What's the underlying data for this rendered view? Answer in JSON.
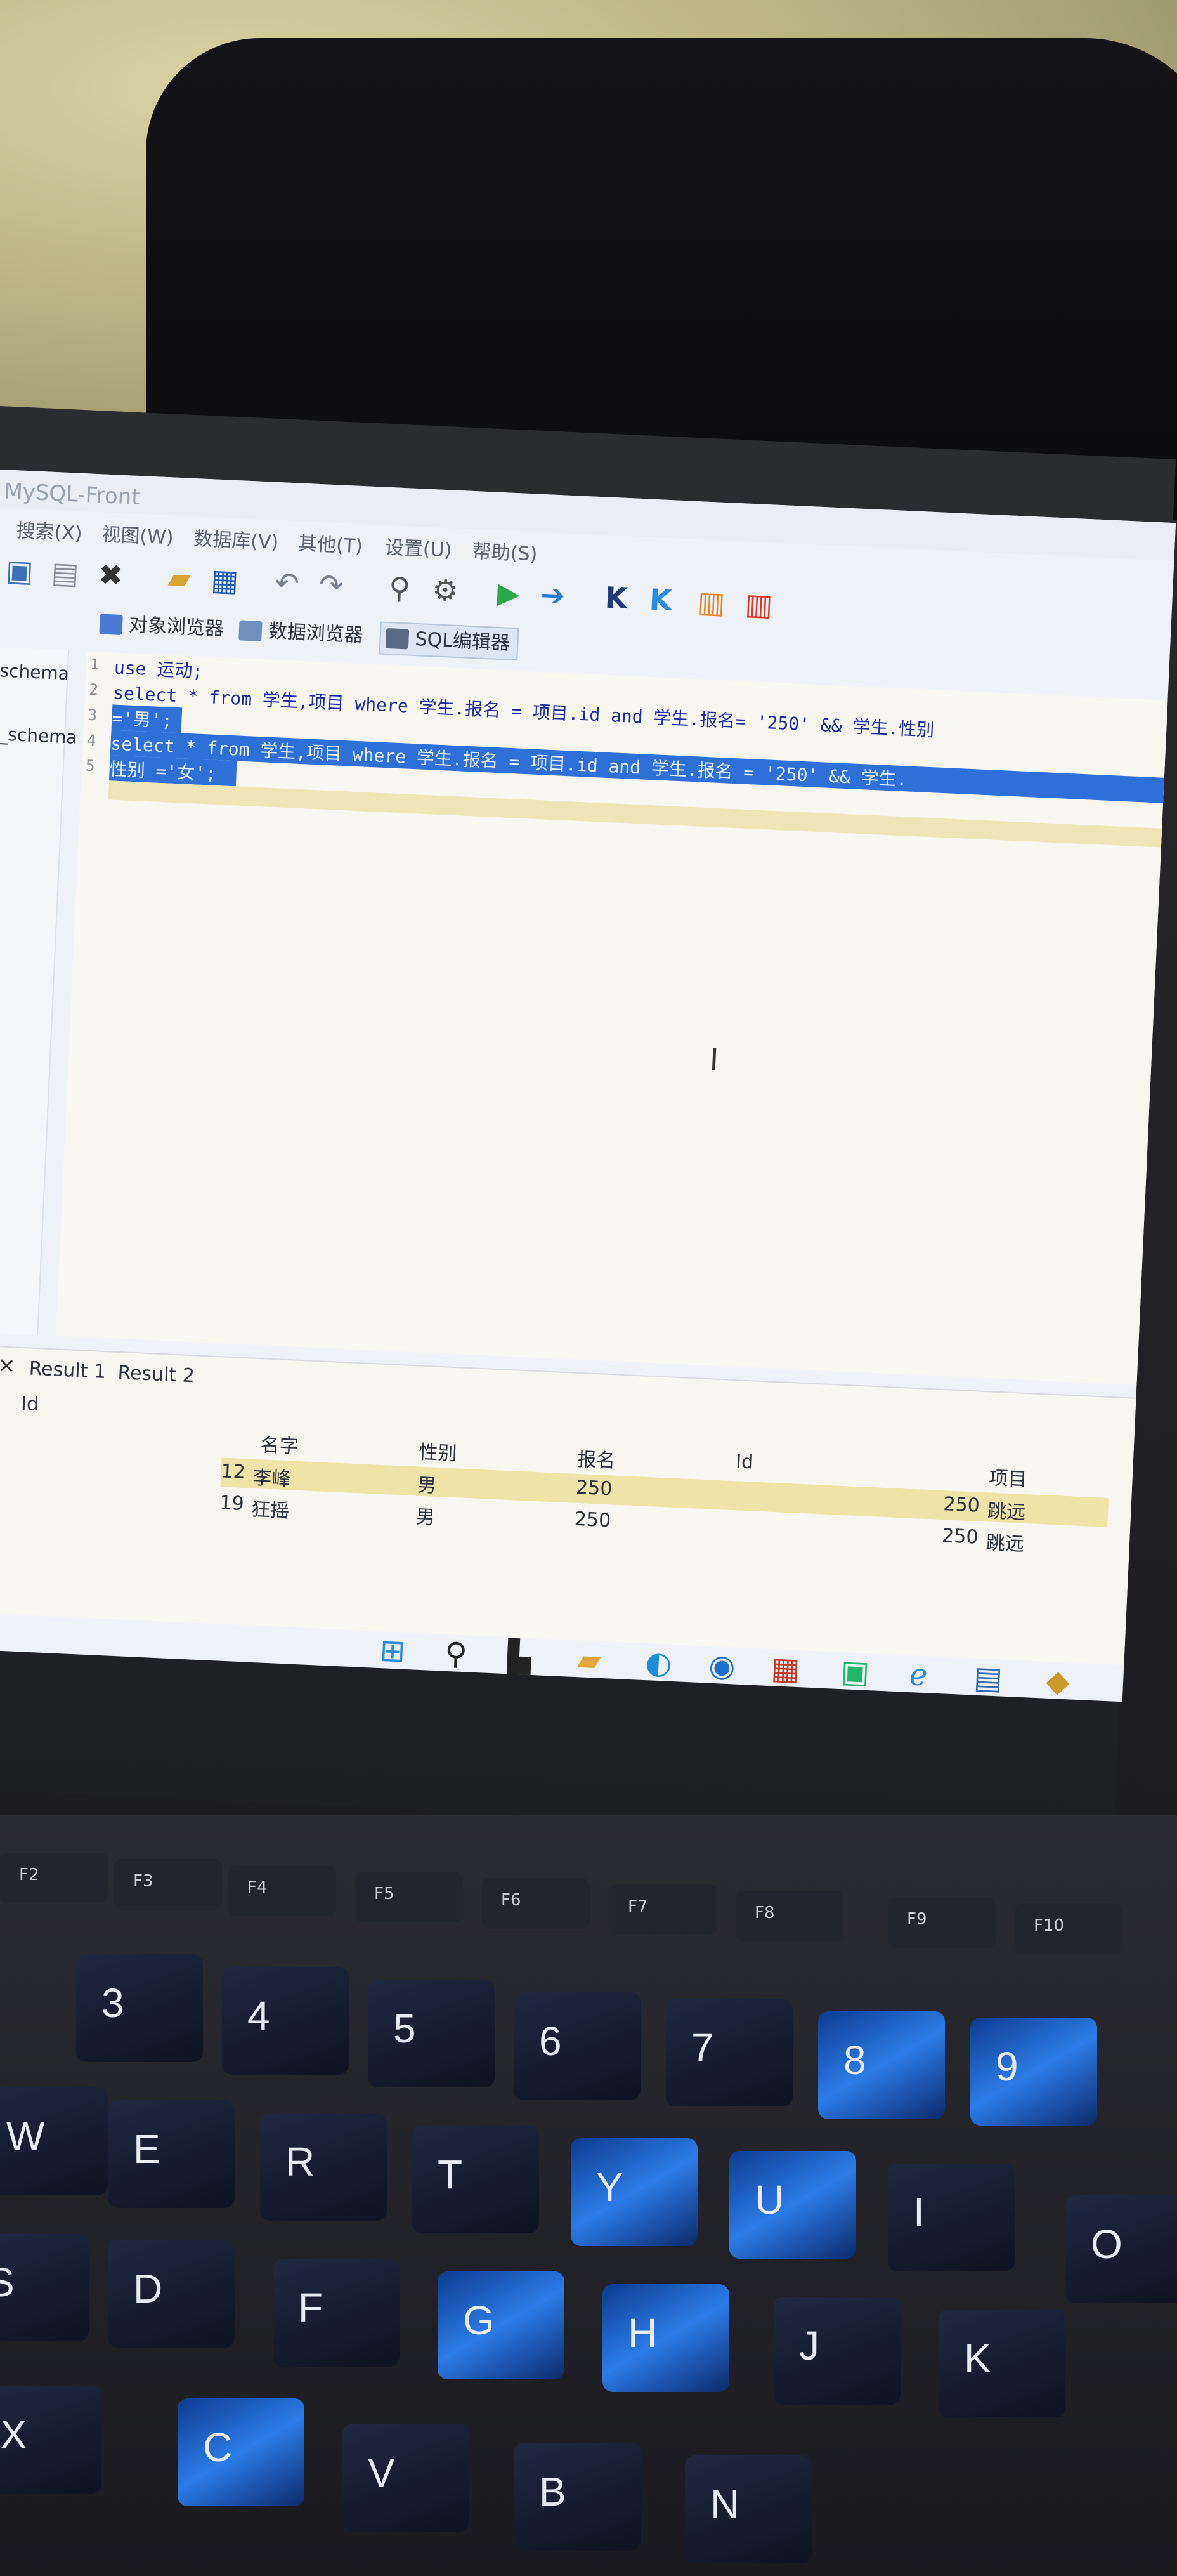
{
  "window": {
    "title": "MySQL-Front"
  },
  "menu": [
    "搜索(X)",
    "视图(W)",
    "数据库(V)",
    "其他(T)",
    "设置(U)",
    "帮助(S)"
  ],
  "tabs": [
    {
      "label": "对象浏览器",
      "color": "#4a7bd0"
    },
    {
      "label": "数据浏览器",
      "color": "#6f8fbf"
    },
    {
      "label": "SQL编辑器",
      "color": "#5a6a80"
    }
  ],
  "sidebar": [
    "_schema",
    "e_schema"
  ],
  "editor": {
    "lines": [
      {
        "n": "1",
        "text": "use 运动;"
      },
      {
        "n": "2",
        "text": "select * from 学生,项目 where 学生.报名 = 项目.id and 学生.报名= '250' && 学生.性别"
      },
      {
        "n": "3",
        "text": "='男';"
      },
      {
        "n": "4",
        "text": "select * from 学生,项目 where 学生.报名 = 项目.id and 学生.报名 = '250' && 学生."
      },
      {
        "n": "5",
        "text": "性别 ='女';"
      }
    ]
  },
  "results": {
    "tabs": [
      "Result 1",
      "Result 2"
    ],
    "close": "×",
    "headers": [
      "Id",
      "名字",
      "性别",
      "报名",
      "Id",
      "项目"
    ],
    "rows": [
      {
        "id": "12",
        "name": "李峰",
        "gender": "男",
        "reg": "250",
        "pid": "250",
        "project": "跳远"
      },
      {
        "id": "19",
        "name": "狂摇",
        "gender": "男",
        "reg": "250",
        "pid": "250",
        "project": "跳远"
      }
    ]
  },
  "keyboard": {
    "row1": [
      "3",
      "4",
      "5",
      "6",
      "7",
      "8",
      "9"
    ],
    "row2": [
      "W",
      "E",
      "R",
      "T",
      "Y",
      "U",
      "I"
    ],
    "row3": [
      "S",
      "D",
      "F",
      "G",
      "H",
      "J",
      "K",
      "O"
    ],
    "row4": [
      "X",
      "C",
      "V",
      "B",
      "N"
    ],
    "fkeys": [
      "F2",
      "F3",
      "F4",
      "F5",
      "F6",
      "F7",
      "F8",
      "F9",
      "F10"
    ]
  }
}
